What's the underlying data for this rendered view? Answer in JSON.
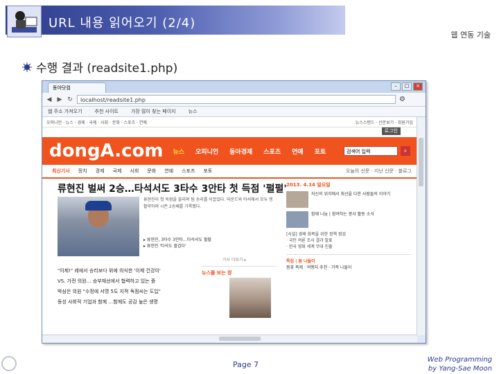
{
  "slide": {
    "title": "URL 내용 읽어오기 (2/4)",
    "course": "웹 연동 기술",
    "bullet": "수행 결과 (readsite1.php)",
    "page": "Page 7",
    "credit_line1": "Web Programming",
    "credit_line2": "by Yang-Sae Moon"
  },
  "browser": {
    "tab_title": "동아닷컴",
    "url": "localhost/readsite1.php",
    "bookmarks": [
      "웹 주소 가져오기",
      "추천 사이트",
      "가장 많이 찾는 페이지",
      "뉴스"
    ],
    "window_buttons": [
      "–",
      "□",
      "×"
    ]
  },
  "site": {
    "top_left": "오피니언 · 뉴스 · 경제 · 국제 · 사회 · 문화 · 스포츠 · 연예",
    "top_right": "뉴스스탠드 · 신문보기 · 회원가입",
    "login": "로그인",
    "logo": "dongA.com",
    "nav": [
      "뉴스",
      "오피니언",
      "동아경제",
      "스포츠",
      "연예",
      "포토"
    ],
    "search_placeholder": "검색어 입력",
    "search_icon": "search-icon",
    "subnav": [
      "최신기사",
      "정치",
      "경제",
      "국제",
      "사회",
      "문화",
      "연예",
      "스포츠",
      "포토"
    ],
    "subnav_right": "오늘의 신문 · 지난 신문 · 블로그",
    "headline": "류현진 벌써 2승…타석서도 3타수 3안타 첫 득점 '펄펄'",
    "article_text": "류현진이 첫 득점을 올리며 팀 승리를 이끌었다. 마운드와 타석에서 모두 맹활약하며 시즌 2승째를 기록했다.",
    "related": [
      "▸ 류현진, 3타수 3안타…타석서도 펄펄",
      "▸ 류현진 '타석도 즐겁다'"
    ],
    "more": "기사 더보기 ▸",
    "list": [
      "\"이제!\" 레에서 승리보다 위에 의식한 '이제 건강이'",
      "VS. 가전 의원… 승부재선에서 협력하고 있는 중",
      "박삼은 의원 \"수정에 서명 5도 지적 독점씨는 도입\"",
      "동성 사회적 기업과 함께 …함께도 공감 높은 생명"
    ],
    "column_title": "뉴스를 보는 창",
    "date": "2013. 4.14 일요일",
    "side_items": [
      "자신의 위치에서 최선을 다한 사람들의 이야기",
      "함께 나눔 | 참여하는 봉사 활동 소식"
    ],
    "side_list": [
      "[사설] 경제 회복을 위한 정책 점검",
      "· 국민 여론 조사 결과 발표",
      "· 한국 영화 세계 무대 진출"
    ],
    "special_title": "특집 | 봄 나들이",
    "special_text": "봄꽃 축제 · 여행지 추천 · 가족 나들이"
  }
}
